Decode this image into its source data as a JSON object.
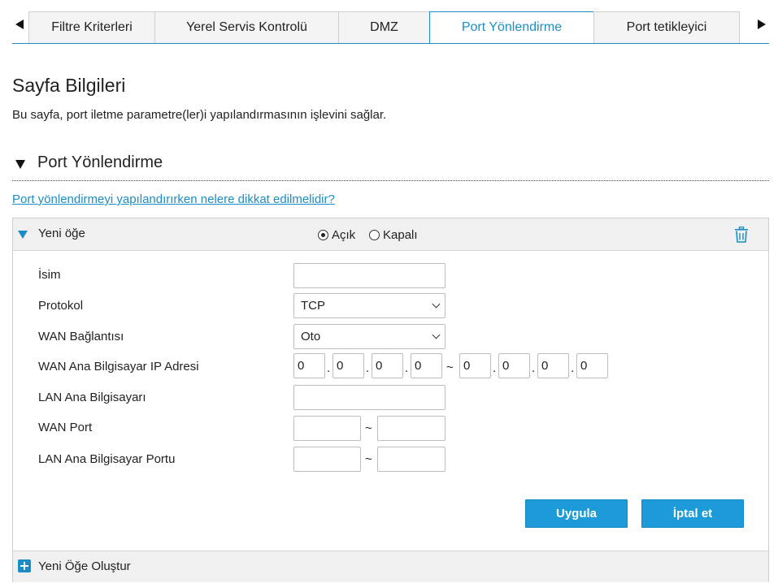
{
  "tabs": [
    "Filtre Kriterleri",
    "Yerel Servis Kontrolü",
    "DMZ",
    "Port Yönlendirme",
    "Port tetikleyici"
  ],
  "active_tab_index": 3,
  "page": {
    "title": "Sayfa Bilgileri",
    "description": "Bu sayfa, port iletme parametre(ler)i yapılandırmasının işlevini sağlar."
  },
  "section": {
    "title": "Port Yönlendirme"
  },
  "help_link": "Port yönlendirmeyi yapılandırırken nelere dikkat edilmelidir?",
  "item": {
    "title": "Yeni öğe",
    "radio_on": "Açık",
    "radio_off": "Kapalı",
    "selected": "Açık"
  },
  "form": {
    "name_label": "İsim",
    "name_value": "",
    "protocol_label": "Protokol",
    "protocol_value": "TCP",
    "wan_conn_label": "WAN Bağlantısı",
    "wan_conn_value": "Oto",
    "wan_ip_label": "WAN Ana Bilgisayar IP Adresi",
    "wan_ip_start": [
      "0",
      "0",
      "0",
      "0"
    ],
    "wan_ip_end": [
      "0",
      "0",
      "0",
      "0"
    ],
    "ip_dot": ".",
    "range_sep": "~",
    "lan_host_label": "LAN Ana Bilgisayarı",
    "lan_host_value": "",
    "wan_port_label": "WAN Port",
    "wan_port_start": "",
    "wan_port_end": "",
    "lan_port_label": "LAN Ana Bilgisayar Portu",
    "lan_port_start": "",
    "lan_port_end": ""
  },
  "buttons": {
    "apply": "Uygula",
    "cancel": "İptal et"
  },
  "footer": {
    "create_label": "Yeni Öğe Oluştur"
  },
  "colors": {
    "accent": "#1a8ec4",
    "button": "#1d9bd8",
    "panel_bg": "#f0f0f0"
  }
}
